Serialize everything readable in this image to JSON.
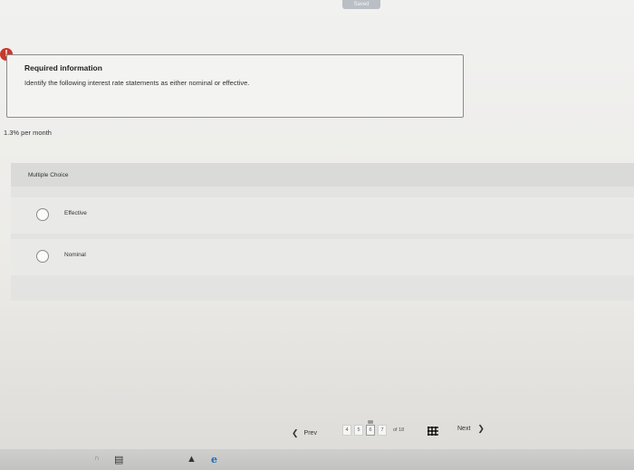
{
  "header": {
    "saved_label": "Saved"
  },
  "alert": {
    "icon": "exclamation-icon",
    "glyph": "!"
  },
  "info": {
    "title": "Required information",
    "text": "Identify the following interest rate statements as either nominal or effective."
  },
  "question": {
    "text": "1.3% per month"
  },
  "multiple_choice": {
    "label": "Multiple Choice",
    "options": [
      {
        "label": "Effective"
      },
      {
        "label": "Nominal"
      }
    ]
  },
  "footer": {
    "prev_label": "Prev",
    "next_label": "Next",
    "pages": [
      "4",
      "5",
      "6",
      "7"
    ],
    "current_page": "6",
    "of_text": "of 18",
    "prev_icon": "chevron-left-icon",
    "next_icon": "chevron-right-icon",
    "grid_icon": "grid-icon"
  },
  "taskbar": {
    "icons": [
      "file-explorer-icon",
      "store-icon",
      "app-icon",
      "edge-icon"
    ]
  }
}
